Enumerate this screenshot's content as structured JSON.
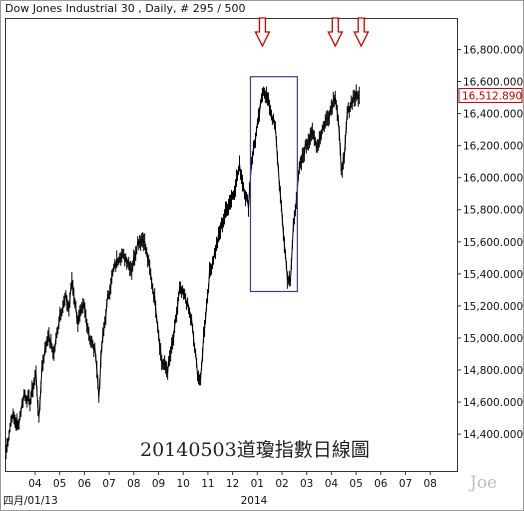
{
  "chart_data": {
    "type": "line",
    "title": "Dow Jones Industrial 30 , Daily, # 295 / 500",
    "annotation": "20140503道瓊指數日線圖",
    "watermark": "Joe",
    "last_value_label": "16,512.890",
    "last_value": 16512.89,
    "y_axis": {
      "position": "right",
      "ylim": [
        14170,
        16990
      ],
      "ticks": [
        14400,
        14600,
        14800,
        15000,
        15200,
        15400,
        15600,
        15800,
        16000,
        16200,
        16400,
        16600,
        16800
      ],
      "tick_labels": [
        "14,400.000",
        "14,600.000",
        "14,800.000",
        "15,000.000",
        "15,200.000",
        "15,400.000",
        "15,600.000",
        "15,800.000",
        "16,000.000",
        "16,200.000",
        "16,400.000",
        "16,600.000",
        "16,800.000"
      ]
    },
    "x_axis": {
      "tick_labels": [
        "04",
        "05",
        "06",
        "07",
        "08",
        "09",
        "10",
        "11",
        "12",
        "01",
        "02",
        "03",
        "04",
        "05",
        "06",
        "07",
        "08"
      ],
      "secondary_labels": [
        "四月/01/13",
        "2014"
      ]
    },
    "grid": false,
    "series": [
      {
        "values": [
          [
            0,
            14290
          ],
          [
            6,
            14520
          ],
          [
            12,
            14450
          ],
          [
            18,
            14650
          ],
          [
            24,
            14600
          ],
          [
            30,
            14780
          ],
          [
            33,
            14480
          ],
          [
            36,
            14820
          ],
          [
            42,
            15020
          ],
          [
            48,
            14900
          ],
          [
            54,
            15150
          ],
          [
            60,
            15250
          ],
          [
            63,
            15180
          ],
          [
            66,
            15360
          ],
          [
            72,
            15100
          ],
          [
            78,
            15200
          ],
          [
            84,
            15000
          ],
          [
            90,
            14900
          ],
          [
            93,
            14630
          ],
          [
            96,
            14950
          ],
          [
            102,
            15250
          ],
          [
            108,
            15430
          ],
          [
            114,
            15520
          ],
          [
            120,
            15500
          ],
          [
            126,
            15430
          ],
          [
            132,
            15600
          ],
          [
            138,
            15620
          ],
          [
            144,
            15430
          ],
          [
            150,
            15200
          ],
          [
            156,
            14850
          ],
          [
            162,
            14800
          ],
          [
            168,
            15000
          ],
          [
            174,
            15300
          ],
          [
            180,
            15250
          ],
          [
            186,
            15100
          ],
          [
            192,
            14780
          ],
          [
            195,
            14720
          ],
          [
            198,
            15010
          ],
          [
            204,
            15400
          ],
          [
            210,
            15550
          ],
          [
            216,
            15700
          ],
          [
            222,
            15820
          ],
          [
            228,
            15900
          ],
          [
            234,
            16070
          ],
          [
            240,
            15890
          ],
          [
            243,
            15830
          ],
          [
            246,
            16100
          ],
          [
            252,
            16320
          ],
          [
            258,
            16560
          ],
          [
            264,
            16450
          ],
          [
            270,
            16300
          ],
          [
            276,
            15800
          ],
          [
            282,
            15380
          ],
          [
            285,
            15340
          ],
          [
            288,
            15700
          ],
          [
            294,
            16050
          ],
          [
            300,
            16190
          ],
          [
            306,
            16280
          ],
          [
            312,
            16200
          ],
          [
            318,
            16320
          ],
          [
            324,
            16400
          ],
          [
            330,
            16520
          ],
          [
            333,
            16350
          ],
          [
            336,
            16060
          ],
          [
            339,
            16100
          ],
          [
            342,
            16400
          ],
          [
            348,
            16500
          ],
          [
            354,
            16512.89
          ]
        ]
      }
    ],
    "highlight_box": {
      "x_range": [
        245,
        292
      ],
      "y_range": [
        15290,
        16630
      ]
    },
    "markers": [
      {
        "type": "down-arrow",
        "x": 257
      },
      {
        "type": "down-arrow",
        "x": 330
      },
      {
        "type": "down-arrow",
        "x": 356
      }
    ],
    "arrow_color": "#cc0000",
    "box_color": "#3b3b9a",
    "line_color": "#000000"
  }
}
